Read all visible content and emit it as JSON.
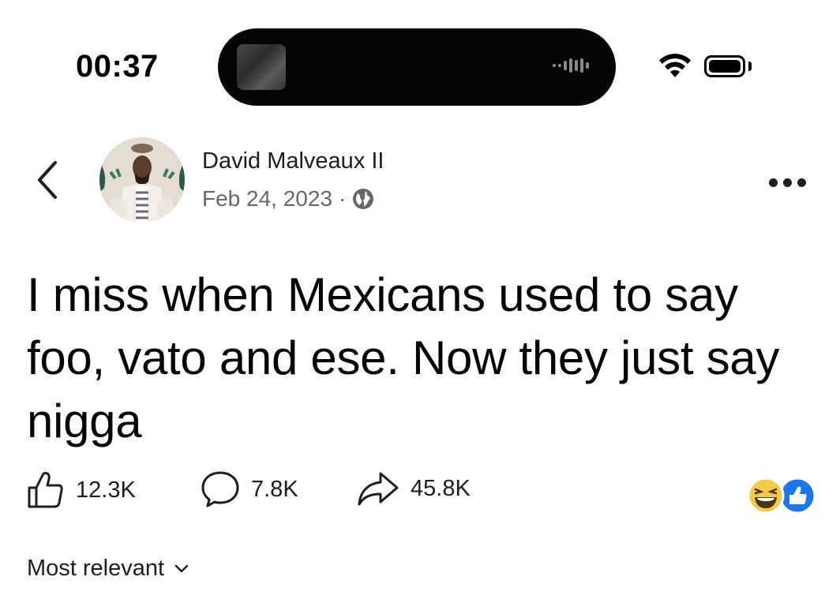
{
  "status_bar": {
    "time": "00:37",
    "icons": [
      "wifi-icon",
      "battery-icon"
    ]
  },
  "post": {
    "author": "David Malveaux II",
    "date": "Feb 24, 2023",
    "separator": "·",
    "privacy_icon": "globe-icon",
    "text": "I miss when Mexicans used to say foo, vato and ese. Now they just say nigga",
    "likes": "12.3K",
    "comments": "7.8K",
    "shares": "45.8K",
    "reactions": [
      "laughing-emoji",
      "like-reaction"
    ]
  },
  "comments_filter": {
    "label": "Most relevant"
  },
  "colors": {
    "like_blue": "#1877f2",
    "emoji_yellow": "#f7c948",
    "meta_gray": "#65676b"
  }
}
